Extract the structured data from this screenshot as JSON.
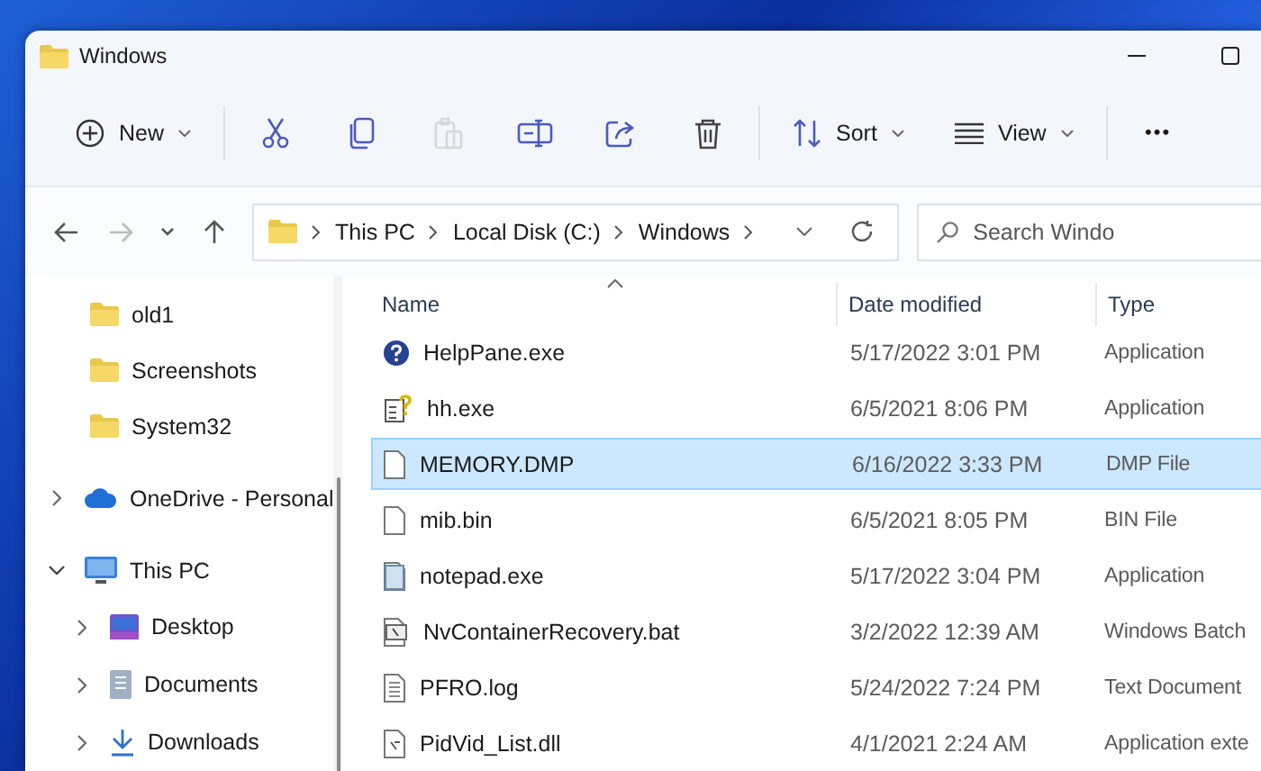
{
  "window": {
    "title": "Windows"
  },
  "toolbar": {
    "groups": [
      [
        {
          "kind": "menu",
          "label": "New",
          "disabled": false
        }
      ],
      [
        {
          "kind": "action",
          "disabled": false
        },
        {
          "kind": "action",
          "disabled": false
        },
        {
          "kind": "action",
          "disabled": true
        },
        {
          "kind": "action",
          "disabled": false
        },
        {
          "kind": "action",
          "disabled": false
        },
        {
          "kind": "action",
          "disabled": false
        }
      ],
      [
        {
          "kind": "menu",
          "label": "Sort",
          "disabled": false
        },
        {
          "kind": "menu",
          "label": "View",
          "disabled": false
        }
      ],
      [
        {
          "kind": "more",
          "label": "•••",
          "disabled": false
        }
      ]
    ]
  },
  "address_bar": {
    "breadcrumb": [
      "This PC",
      "Local Disk (C:)",
      "Windows"
    ]
  },
  "search": {
    "placeholder": "Search Windo"
  },
  "nav_pane": {
    "continued_children": [
      {
        "label": "old1"
      },
      {
        "label": "Screenshots"
      },
      {
        "label": "System32"
      }
    ],
    "items": [
      {
        "label": "OneDrive - Personal",
        "expanded": false
      },
      {
        "label": "This PC",
        "expanded": true,
        "children": [
          {
            "label": "Desktop",
            "expanded": false
          },
          {
            "label": "Documents",
            "expanded": false
          },
          {
            "label": "Downloads",
            "expanded": false
          }
        ]
      }
    ]
  },
  "file_list": {
    "columns": [
      "Name",
      "Date modified",
      "Type"
    ],
    "rows": [
      {
        "name": "HelpPane.exe",
        "date": "5/17/2022 3:01 PM",
        "type": "Application",
        "selected": false
      },
      {
        "name": "hh.exe",
        "date": "6/5/2021 8:06 PM",
        "type": "Application",
        "selected": false
      },
      {
        "name": "MEMORY.DMP",
        "date": "6/16/2022 3:33 PM",
        "type": "DMP File",
        "selected": true
      },
      {
        "name": "mib.bin",
        "date": "6/5/2021 8:05 PM",
        "type": "BIN File",
        "selected": false
      },
      {
        "name": "notepad.exe",
        "date": "5/17/2022 3:04 PM",
        "type": "Application",
        "selected": false
      },
      {
        "name": "NvContainerRecovery.bat",
        "date": "3/2/2022 12:39 AM",
        "type": "Windows Batch",
        "selected": false
      },
      {
        "name": "PFRO.log",
        "date": "5/24/2022 7:24 PM",
        "type": "Text Document",
        "selected": false
      },
      {
        "name": "PidVid_List.dll",
        "date": "4/1/2021 2:24 AM",
        "type": "Application exte",
        "selected": false
      }
    ]
  }
}
